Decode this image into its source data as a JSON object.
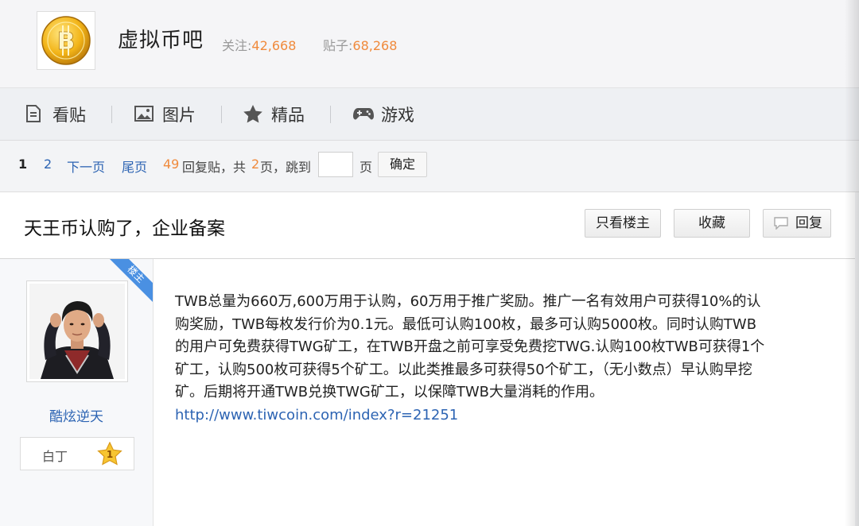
{
  "forum": {
    "name": "虚拟币吧",
    "follow_label": "关注:",
    "follow_count": "42,668",
    "posts_label": "贴子:",
    "posts_count": "68,268"
  },
  "nav": {
    "items": [
      {
        "label": "看贴",
        "icon": "document-icon"
      },
      {
        "label": "图片",
        "icon": "image-icon"
      },
      {
        "label": "精品",
        "icon": "star-icon"
      },
      {
        "label": "游戏",
        "icon": "gamepad-icon"
      }
    ]
  },
  "pager": {
    "current": "1",
    "page2": "2",
    "next": "下一页",
    "last": "尾页",
    "reply_count": "49",
    "reply_text": "回复贴，共",
    "total_pages": "2",
    "pages_text": "页，跳到",
    "page_unit": "页",
    "confirm": "确定"
  },
  "thread": {
    "title": "天王币认购了，企业备案",
    "only_op": "只看楼主",
    "favorite": "收藏",
    "reply": "回复"
  },
  "post": {
    "badge": "楼主",
    "username": "酷炫逆天",
    "level_name": "白丁",
    "level": "1",
    "lines": [
      "TWB总量为660万,600万用于认购，60万用于推广奖励。推广一名有效用户可获得10%的认",
      "购奖励，TWB每枚发行价为0.1元。最低可认购100枚，最多可认购5000枚。同时认购TWB",
      "的用户可免费获得TWG矿工，在TWB开盘之前可享受免费挖TWG.认购100枚TWB可获得1个",
      "矿工，认购500枚可获得5个矿工。以此类推最多可获得50个矿工，（无小数点）早认购早挖",
      "矿。后期将开通TWB兑换TWG矿工，以保障TWB大量消耗的作用。"
    ],
    "link": "http://www.tiwcoin.com/index?r=21251"
  },
  "colors": {
    "accent_blue": "#2d64b3",
    "count_orange": "#f08a3c",
    "badge_blue": "#4a90e2"
  }
}
